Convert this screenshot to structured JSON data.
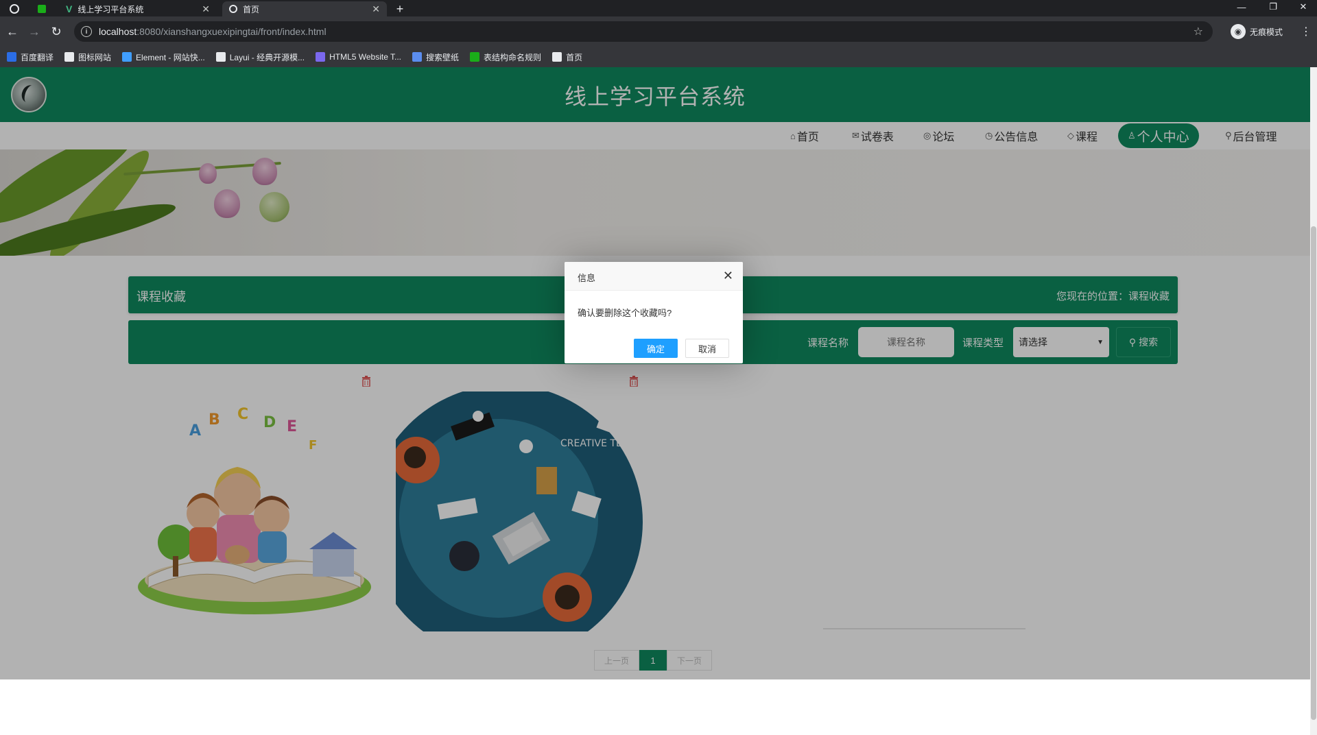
{
  "browser": {
    "tabs": [
      {
        "title": "线上学习平台系统",
        "active": false
      },
      {
        "title": "首页",
        "active": true
      }
    ],
    "address": {
      "host": "localhost",
      "path": ":8080/xianshangxuexipingtai/front/index.html"
    },
    "profile_label": "无痕模式",
    "bookmarks": [
      {
        "label": "百度翻译",
        "color": "#2b6de5"
      },
      {
        "label": "图标网站",
        "color": "#e8eaed"
      },
      {
        "label": "Element - 网站快...",
        "color": "#409eff"
      },
      {
        "label": "Layui - 经典开源模...",
        "color": "#e8eaed"
      },
      {
        "label": "HTML5 Website T...",
        "color": "#7b68ee"
      },
      {
        "label": "搜索壁纸",
        "color": "#5b8def"
      },
      {
        "label": "表结构命名规则",
        "color": "#1aad19"
      },
      {
        "label": "首页",
        "color": "#e8eaed"
      }
    ]
  },
  "site": {
    "title": "线上学习平台系统",
    "accent": "#0f8a5f",
    "nav": [
      {
        "label": "首页",
        "icon": "home-icon",
        "glyph": "⌂"
      },
      {
        "label": "试卷表",
        "icon": "mail-icon",
        "glyph": "✉"
      },
      {
        "label": "论坛",
        "icon": "globe-icon",
        "glyph": "◎"
      },
      {
        "label": "公告信息",
        "icon": "speech-icon",
        "glyph": "◷"
      },
      {
        "label": "课程",
        "icon": "tag-icon",
        "glyph": "◇"
      },
      {
        "label": "个人中心",
        "icon": "user-icon",
        "glyph": "♙",
        "active": true
      },
      {
        "label": "后台管理",
        "icon": "link-icon",
        "glyph": "⚲"
      }
    ]
  },
  "carousel": {
    "slide_count": 3,
    "active_index": 0
  },
  "crumb": {
    "title": "课程收藏",
    "position": "您现在的位置：课程收藏"
  },
  "search": {
    "name_label": "课程名称",
    "name_placeholder": "课程名称",
    "type_label": "课程类型",
    "type_selected": "请选择",
    "button_label": "搜索"
  },
  "cards": [
    {
      "name": "children-book-illustration",
      "caption": "CREATIVE TEAM"
    }
  ],
  "pager": {
    "prev": "上一页",
    "current": "1",
    "next": "下一页"
  },
  "dialog": {
    "title": "信息",
    "message": "确认要删除这个收藏吗?",
    "ok": "确定",
    "cancel": "取消"
  }
}
